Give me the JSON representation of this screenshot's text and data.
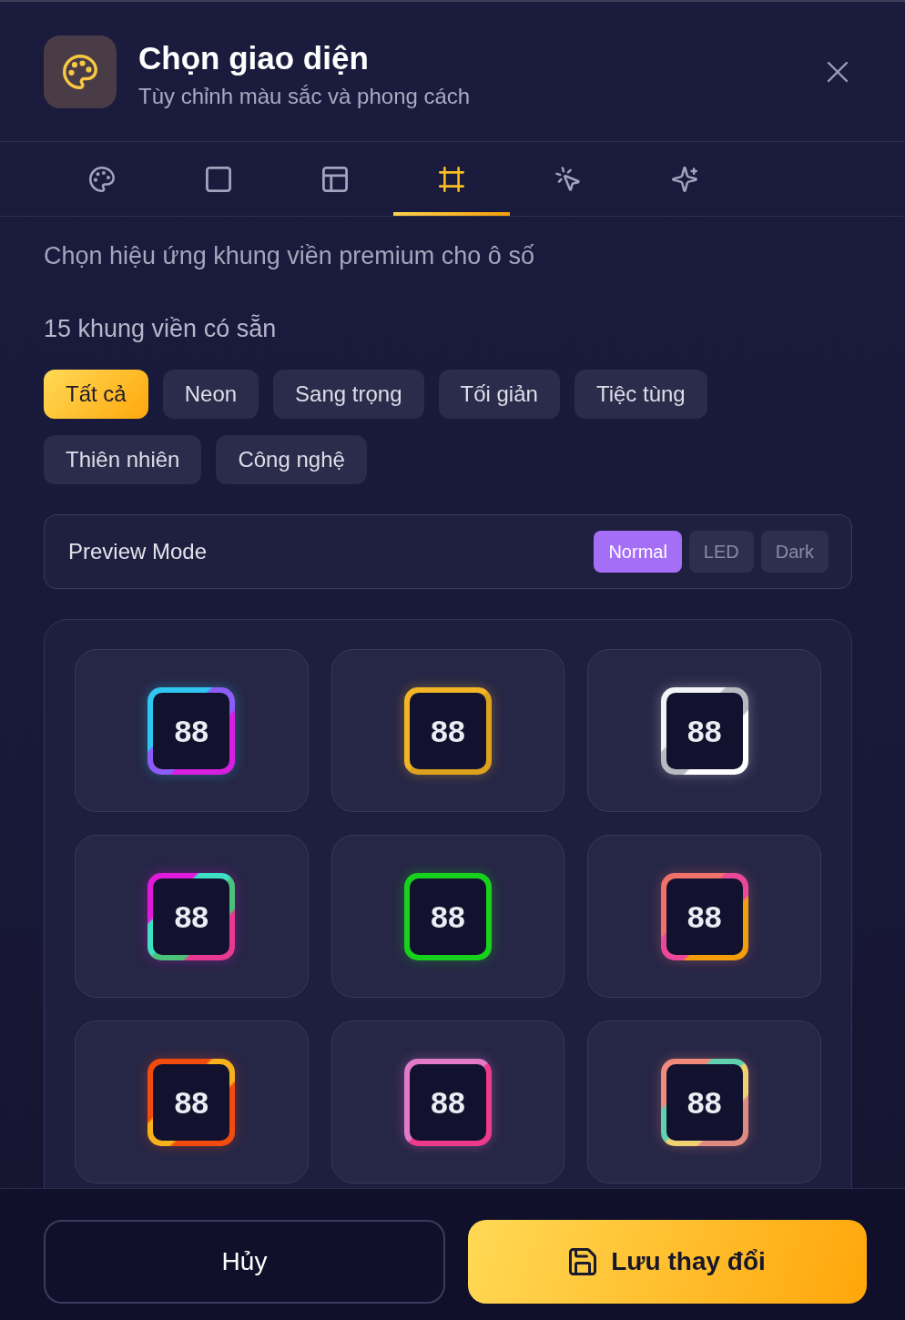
{
  "header": {
    "title": "Chọn giao diện",
    "subtitle": "Tùy chỉnh màu sắc và phong cách"
  },
  "tabs": [
    {
      "selected": false
    },
    {
      "selected": false
    },
    {
      "selected": false
    },
    {
      "selected": true
    },
    {
      "selected": false
    },
    {
      "selected": false
    }
  ],
  "description": "Chọn hiệu ứng khung viền premium cho ô số",
  "count_label": "15 khung viền có sẵn",
  "filters": [
    {
      "label": "Tất cả",
      "selected": true
    },
    {
      "label": "Neon",
      "selected": false
    },
    {
      "label": "Sang trọng",
      "selected": false
    },
    {
      "label": "Tối giản",
      "selected": false
    },
    {
      "label": "Tiệc tùng",
      "selected": false
    },
    {
      "label": "Thiên nhiên",
      "selected": false
    },
    {
      "label": "Công nghệ",
      "selected": false
    }
  ],
  "preview_mode": {
    "label": "Preview Mode",
    "options": [
      {
        "label": "Normal",
        "selected": true
      },
      {
        "label": "LED",
        "selected": false
      },
      {
        "label": "Dark",
        "selected": false
      }
    ]
  },
  "frames": [
    {
      "digits": "88",
      "stops": [
        {
          "color": "#2fc6f0"
        },
        {
          "color": "#8b5cf6"
        },
        {
          "color": "#d61fe0"
        }
      ]
    },
    {
      "digits": "88",
      "stops": [
        {
          "color": "#f2b526"
        },
        {
          "color": "#dca21e"
        }
      ]
    },
    {
      "digits": "88",
      "stops": [
        {
          "color": "#f4f4f7"
        },
        {
          "color": "#b9b9c2"
        },
        {
          "color": "#ffffff"
        }
      ]
    },
    {
      "digits": "88",
      "stops": [
        {
          "color": "#e11ad9"
        },
        {
          "color": "#3ee0c4"
        },
        {
          "color": "#4cc17a"
        },
        {
          "color": "#e6398f"
        }
      ]
    },
    {
      "digits": "88",
      "stops": [
        {
          "color": "#17d11c"
        }
      ]
    },
    {
      "digits": "88",
      "stops": [
        {
          "color": "#f0706a"
        },
        {
          "color": "#ec4899"
        },
        {
          "color": "#f59e0b"
        }
      ]
    },
    {
      "digits": "88",
      "stops": [
        {
          "color": "#f24b0d"
        },
        {
          "color": "#f5b21a"
        },
        {
          "color": "#f24b0d"
        }
      ]
    },
    {
      "digits": "88",
      "stops": [
        {
          "color": "#e27ac8"
        },
        {
          "color": "#ec3a8c"
        }
      ]
    },
    {
      "digits": "88",
      "stops": [
        {
          "color": "#f08a7a"
        },
        {
          "color": "#5fd0b0"
        },
        {
          "color": "#f0d070"
        },
        {
          "color": "#e08a80"
        }
      ]
    }
  ],
  "footer": {
    "cancel": "Hủy",
    "save": "Lưu thay đổi"
  }
}
